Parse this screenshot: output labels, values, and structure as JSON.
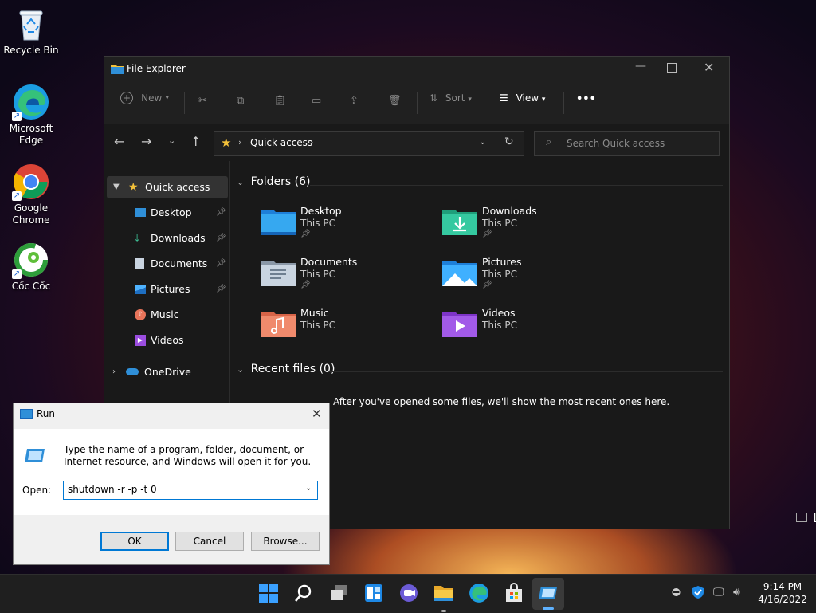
{
  "desktop": {
    "icons": [
      {
        "label": "Recycle Bin",
        "icon": "recycle-bin-icon"
      },
      {
        "label": "Microsoft Edge",
        "icon": "edge-icon"
      },
      {
        "label": "Google Chrome",
        "icon": "chrome-icon"
      },
      {
        "label": "Cốc Cốc",
        "icon": "coccoc-icon"
      }
    ]
  },
  "explorer": {
    "title": "File Explorer",
    "toolbar": {
      "new_label": "New",
      "sort_label": "Sort",
      "view_label": "View",
      "more_label": "•••"
    },
    "address": {
      "location": "Quick access"
    },
    "search": {
      "placeholder": "Search Quick access"
    },
    "nav": {
      "quick_access": "Quick access",
      "items": [
        {
          "label": "Desktop",
          "pinned": true
        },
        {
          "label": "Downloads",
          "pinned": true
        },
        {
          "label": "Documents",
          "pinned": true
        },
        {
          "label": "Pictures",
          "pinned": true
        },
        {
          "label": "Music",
          "pinned": false
        },
        {
          "label": "Videos",
          "pinned": false
        }
      ],
      "onedrive": "OneDrive"
    },
    "folders_header": "Folders (6)",
    "folders": [
      {
        "name": "Desktop",
        "location": "This PC",
        "pinned": true
      },
      {
        "name": "Downloads",
        "location": "This PC",
        "pinned": true
      },
      {
        "name": "Documents",
        "location": "This PC",
        "pinned": true
      },
      {
        "name": "Pictures",
        "location": "This PC",
        "pinned": true
      },
      {
        "name": "Music",
        "location": "This PC",
        "pinned": false
      },
      {
        "name": "Videos",
        "location": "This PC",
        "pinned": false
      }
    ],
    "recent_header": "Recent files (0)",
    "recent_empty": "After you've opened some files, we'll show the most recent ones here."
  },
  "run": {
    "title": "Run",
    "description": "Type the name of a program, folder, document, or Internet resource, and Windows will open it for you.",
    "open_label": "Open:",
    "command": "shutdown -r -p -t 0",
    "ok": "OK",
    "cancel": "Cancel",
    "browse": "Browse..."
  },
  "taskbar": {
    "time": "9:14 PM",
    "date": "4/16/2022"
  },
  "colors": {
    "accent": "#0078d4",
    "folder_yellow": "#f3c13a",
    "explorer_bg": "#191919"
  }
}
